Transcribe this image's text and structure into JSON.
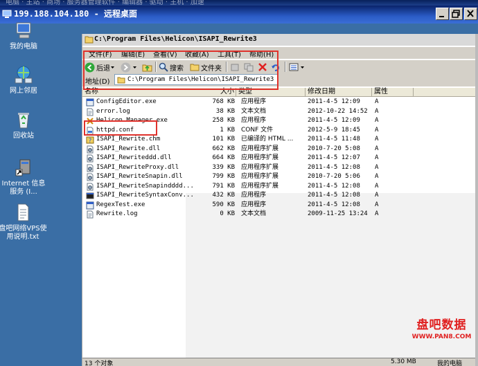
{
  "remote_desktop": {
    "title": "199.188.104.180 - 远程桌面",
    "faint_text": "电脑 · 主站 · 商场 · 服务器管理软件 · 编辑器 · 驱动 · 主机 · 加速"
  },
  "desktop_icons": [
    {
      "label": "我的电脑"
    },
    {
      "label": "网上邻居"
    },
    {
      "label": "回收站"
    },
    {
      "label": "Internet 信息服务 (I..."
    },
    {
      "label": "盘吧网络VPS使用说明.txt"
    }
  ],
  "explorer": {
    "title": "C:\\Program Files\\Helicon\\ISAPI_Rewrite3",
    "menu": [
      "文件(F)",
      "编辑(E)",
      "查看(V)",
      "收藏(A)",
      "工具(T)",
      "帮助(H)"
    ],
    "toolbar": {
      "back": "后退",
      "search": "搜索",
      "folders": "文件夹"
    },
    "address": {
      "label": "地址(D)",
      "value": "C:\\Program Files\\Helicon\\ISAPI_Rewrite3"
    },
    "columns": [
      "名称",
      "大小",
      "类型",
      "修改日期",
      "属性"
    ],
    "files": [
      {
        "name": "ConfigEditor.exe",
        "size": "768 KB",
        "type": "应用程序",
        "date": "2011-4-5 12:09",
        "attr": "A",
        "icon": "exe-icon"
      },
      {
        "name": "error.log",
        "size": "38 KB",
        "type": "文本文档",
        "date": "2012-10-22 14:52",
        "attr": "A",
        "icon": "text-file-icon"
      },
      {
        "name": "Helicon Manager.exe",
        "size": "258 KB",
        "type": "应用程序",
        "date": "2011-4-5 12:09",
        "attr": "A",
        "icon": "helicon-exe-icon"
      },
      {
        "name": "httpd.conf",
        "size": "1 KB",
        "type": "CONF 文件",
        "date": "2012-5-9 18:45",
        "attr": "A",
        "icon": "conf-file-icon"
      },
      {
        "name": "ISAPI_Rewrite.chm",
        "size": "101 KB",
        "type": "已编译的 HTML ...",
        "date": "2011-4-5 11:48",
        "attr": "A",
        "icon": "chm-help-icon"
      },
      {
        "name": "ISAPI_Rewrite.dll",
        "size": "662 KB",
        "type": "应用程序扩展",
        "date": "2010-7-20 5:08",
        "attr": "A",
        "icon": "dll-icon"
      },
      {
        "name": "ISAPI_Rewriteddd.dll",
        "size": "664 KB",
        "type": "应用程序扩展",
        "date": "2011-4-5 12:07",
        "attr": "A",
        "icon": "dll-icon"
      },
      {
        "name": "ISAPI_RewriteProxy.dll",
        "size": "339 KB",
        "type": "应用程序扩展",
        "date": "2011-4-5 12:08",
        "attr": "A",
        "icon": "dll-icon"
      },
      {
        "name": "ISAPI_RewriteSnapin.dll",
        "size": "799 KB",
        "type": "应用程序扩展",
        "date": "2010-7-20 5:06",
        "attr": "A",
        "icon": "dll-icon"
      },
      {
        "name": "ISAPI_RewriteSnapindddd...",
        "size": "791 KB",
        "type": "应用程序扩展",
        "date": "2011-4-5 12:08",
        "attr": "A",
        "icon": "dll-icon"
      },
      {
        "name": "ISAPI_RewriteSyntaxConv...",
        "size": "432 KB",
        "type": "应用程序",
        "date": "2011-4-5 12:08",
        "attr": "A",
        "icon": "console-exe-icon"
      },
      {
        "name": "RegexTest.exe",
        "size": "590 KB",
        "type": "应用程序",
        "date": "2011-4-5 12:08",
        "attr": "A",
        "icon": "exe-icon"
      },
      {
        "name": "Rewrite.log",
        "size": "0 KB",
        "type": "文本文档",
        "date": "2009-11-25 13:24",
        "attr": "A",
        "icon": "text-file-icon"
      }
    ],
    "status": {
      "count": "13 个对象",
      "size": "5.30 MB",
      "zone": "我的电脑"
    }
  },
  "watermark": {
    "text": "盘吧数据",
    "url": "WWW.PAN8.COM"
  },
  "colors": {
    "desktop": "#3a6ea5",
    "title_bar": "#0a246a",
    "highlight": "#e0312b",
    "watermark": "#e02020"
  }
}
